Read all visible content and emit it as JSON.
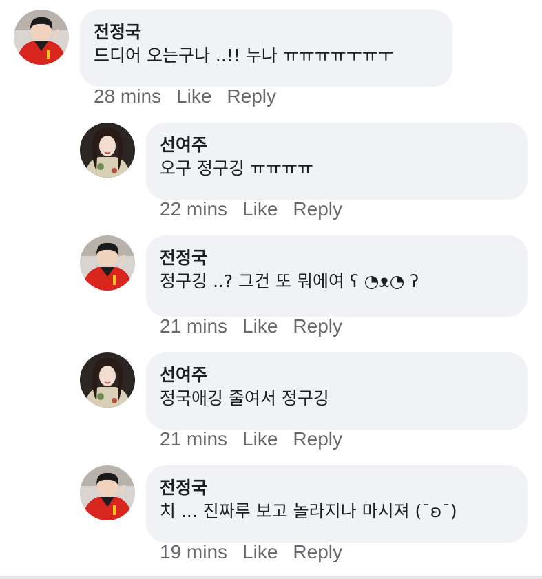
{
  "comments": [
    {
      "author": "전정국",
      "text": "드디어 오는구나 ..!! 누나 ㅠㅠㅠㅠㅜㅠㅜ",
      "time": "28 mins",
      "like_label": "Like",
      "reply_label": "Reply",
      "avatar": "jungkook-avatar"
    },
    {
      "author": "선여주",
      "text": "오구 정구깅 ㅠㅠㅠㅠ",
      "time": "22 mins",
      "like_label": "Like",
      "reply_label": "Reply",
      "avatar": "yeoju-avatar"
    },
    {
      "author": "전정국",
      "text": "정구깅 ..? 그건 또 뭐에여 ʕ ◔ᴥ◔ ʔ",
      "time": "21 mins",
      "like_label": "Like",
      "reply_label": "Reply",
      "avatar": "jungkook-avatar"
    },
    {
      "author": "선여주",
      "text": "정국애깅 줄여서 정구깅",
      "time": "21 mins",
      "like_label": "Like",
      "reply_label": "Reply",
      "avatar": "yeoju-avatar"
    },
    {
      "author": "전정국",
      "text": "치 ... 진짜루 보고 놀라지나 마시져 (¯ʚ¯)",
      "time": "19 mins",
      "like_label": "Like",
      "reply_label": "Reply",
      "avatar": "jungkook-avatar"
    }
  ],
  "colors": {
    "bubble": "#f0f2f5",
    "author_text": "#1c1e21",
    "meta_text": "#65676b"
  }
}
